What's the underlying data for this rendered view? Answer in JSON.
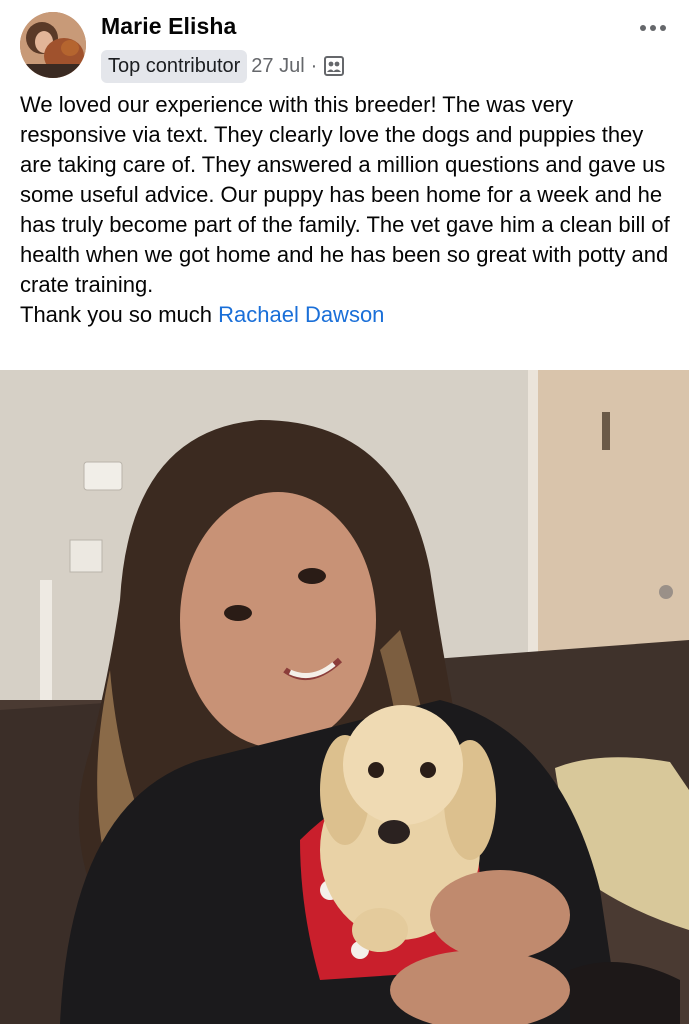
{
  "post": {
    "author_name": "Marie Elisha",
    "badge_label": "Top contributor",
    "date": "27 Jul",
    "separator": "·",
    "audience_icon": "group-members-icon",
    "more_icon": "more-options-icon",
    "body_lines": [
      "We loved our experience with this breeder! The was very responsive via text. They clearly love the dogs and puppies they are taking care of. They answered a million questions and gave us some useful advice. Our puppy has been home for a week and he has truly become part of the family. The vet gave him a clean bill of health when we got home and he has  been so great with potty and crate training."
    ],
    "thanks_text": "Thank you so much ",
    "mention_name": "Rachael Dawson"
  },
  "colors": {
    "link": "#1a6fd8",
    "meta_text": "#65676b",
    "badge_bg": "#e4e6eb"
  }
}
